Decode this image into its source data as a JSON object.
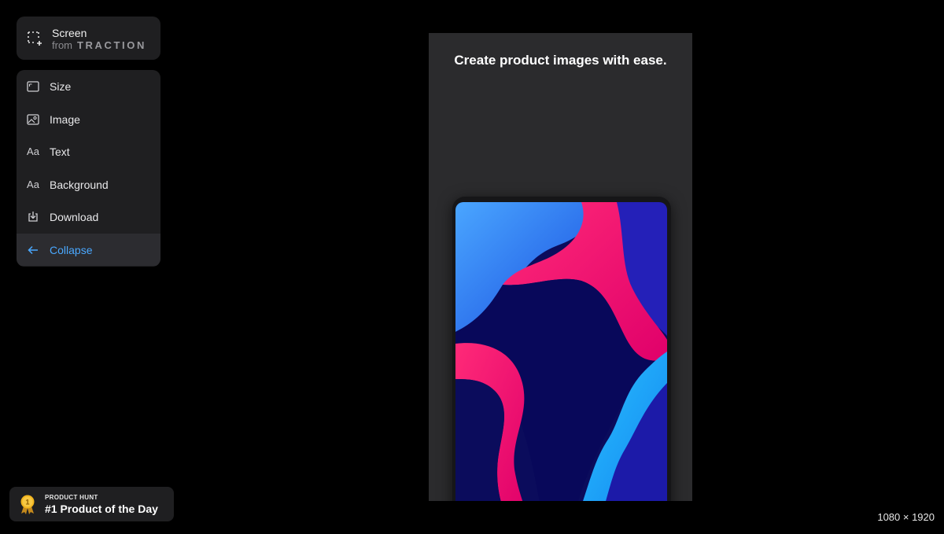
{
  "brand": {
    "title": "Screen",
    "from": "from",
    "company": "TRACTION",
    "icon": "screen-capture-icon"
  },
  "menu": {
    "items": [
      {
        "label": "Size",
        "icon": "frame-icon"
      },
      {
        "label": "Image",
        "icon": "image-icon"
      },
      {
        "label": "Text",
        "icon": "text-aa-icon"
      },
      {
        "label": "Background",
        "icon": "text-aa-icon"
      },
      {
        "label": "Download",
        "icon": "download-icon"
      },
      {
        "label": "Collapse",
        "icon": "arrow-left-icon",
        "active": true
      }
    ]
  },
  "canvas": {
    "headline": "Create product images with ease.",
    "background": "#2b2b2d"
  },
  "badge": {
    "top_label": "PRODUCT HUNT",
    "main_label": "#1 Product of the Day",
    "medal_number": "1",
    "icon": "medal-icon"
  },
  "dimensions": "1080 × 1920",
  "colors": {
    "accent": "#4aa8ff",
    "panel": "#1f1f21"
  }
}
